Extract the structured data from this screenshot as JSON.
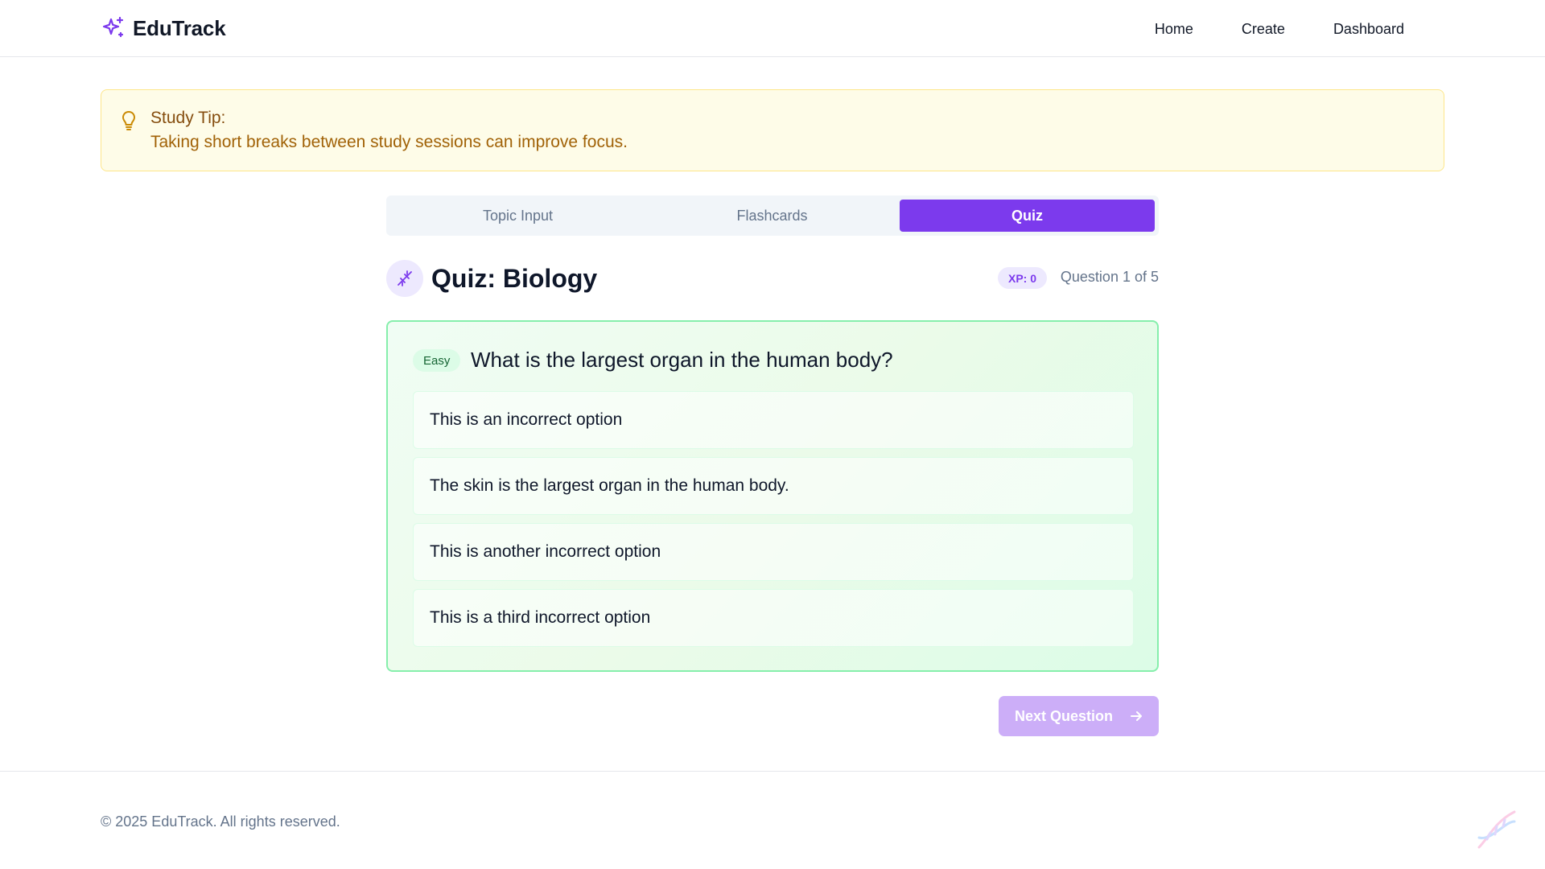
{
  "brand": {
    "name": "EduTrack",
    "icon": "sparkles-icon",
    "accent": "#7c3aed"
  },
  "nav": {
    "items": [
      "Home",
      "Create",
      "Dashboard"
    ]
  },
  "tip": {
    "icon": "lightbulb-icon",
    "title": "Study Tip:",
    "text": "Taking short breaks between study sessions can improve focus."
  },
  "tabs": [
    {
      "label": "Topic Input",
      "active": false
    },
    {
      "label": "Flashcards",
      "active": false
    },
    {
      "label": "Quiz",
      "active": true
    }
  ],
  "quiz": {
    "icon": "dna-icon",
    "title": "Quiz: Biology",
    "xp_label": "XP: 0",
    "progress_text": "Question 1 of 5",
    "difficulty": "Easy",
    "question": "What is the largest organ in the human body?",
    "options": [
      "This is an incorrect option",
      "The skin is the largest organ in the human body.",
      "This is another incorrect option",
      "This is a third incorrect option"
    ],
    "next_label": "Next Question"
  },
  "footer": {
    "copyright": "© 2025 EduTrack. All rights reserved."
  },
  "colors": {
    "tip_bg": "#fefce8",
    "card_border": "#86efac",
    "button": "#c4a1f7"
  }
}
